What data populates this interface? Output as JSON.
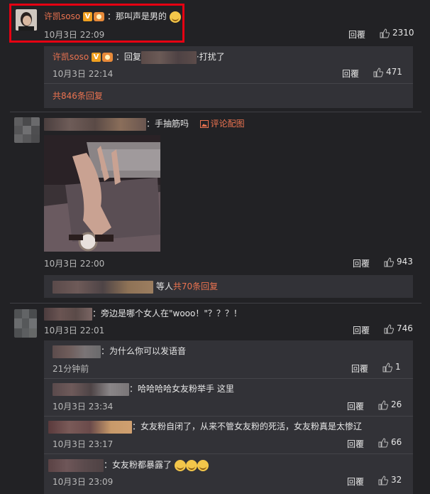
{
  "comments": [
    {
      "user": "许凯soso",
      "text": "：那叫声是男的",
      "time": "10月3日 22:09",
      "reply_label": "回覆",
      "likes": "2310",
      "replies": [
        {
          "user": "许凯soso",
          "text": "：回复",
          "text2": "·打扰了",
          "time": "10月3日 22:14",
          "reply_label": "回覆",
          "likes": "471"
        }
      ],
      "more": "共846条回复"
    },
    {
      "text": "：手抽筋吗",
      "img_link": "评论配图",
      "time": "10月3日 22:00",
      "reply_label": "回覆",
      "likes": "943",
      "summary_prefix": "等人",
      "summary_count": "共70条回复"
    },
    {
      "text": "：旁边是哪个女人在\"wooo！\"？？？！",
      "time": "10月3日 22:01",
      "reply_label": "回覆",
      "likes": "746",
      "replies": [
        {
          "text": "：为什么你可以发语音",
          "time": "21分钟前",
          "reply_label": "回覆",
          "likes": "1"
        },
        {
          "text": "：哈哈哈哈女友粉举手 这里",
          "time": "10月3日 23:34",
          "reply_label": "回覆",
          "likes": "26"
        },
        {
          "text": "：女友粉自闭了，从来不管女友粉的死活，女友粉真是太惨辽",
          "time": "10月3日 23:17",
          "reply_label": "回覆",
          "likes": "66"
        },
        {
          "text": "：女友粉都暴露了",
          "time": "10月3日 23:09",
          "reply_label": "回覆",
          "likes": "32"
        }
      ]
    }
  ],
  "colors": {
    "background": "#222225",
    "reply_background": "#323237",
    "username": "#eb7350",
    "highlight_border": "#e60012"
  }
}
